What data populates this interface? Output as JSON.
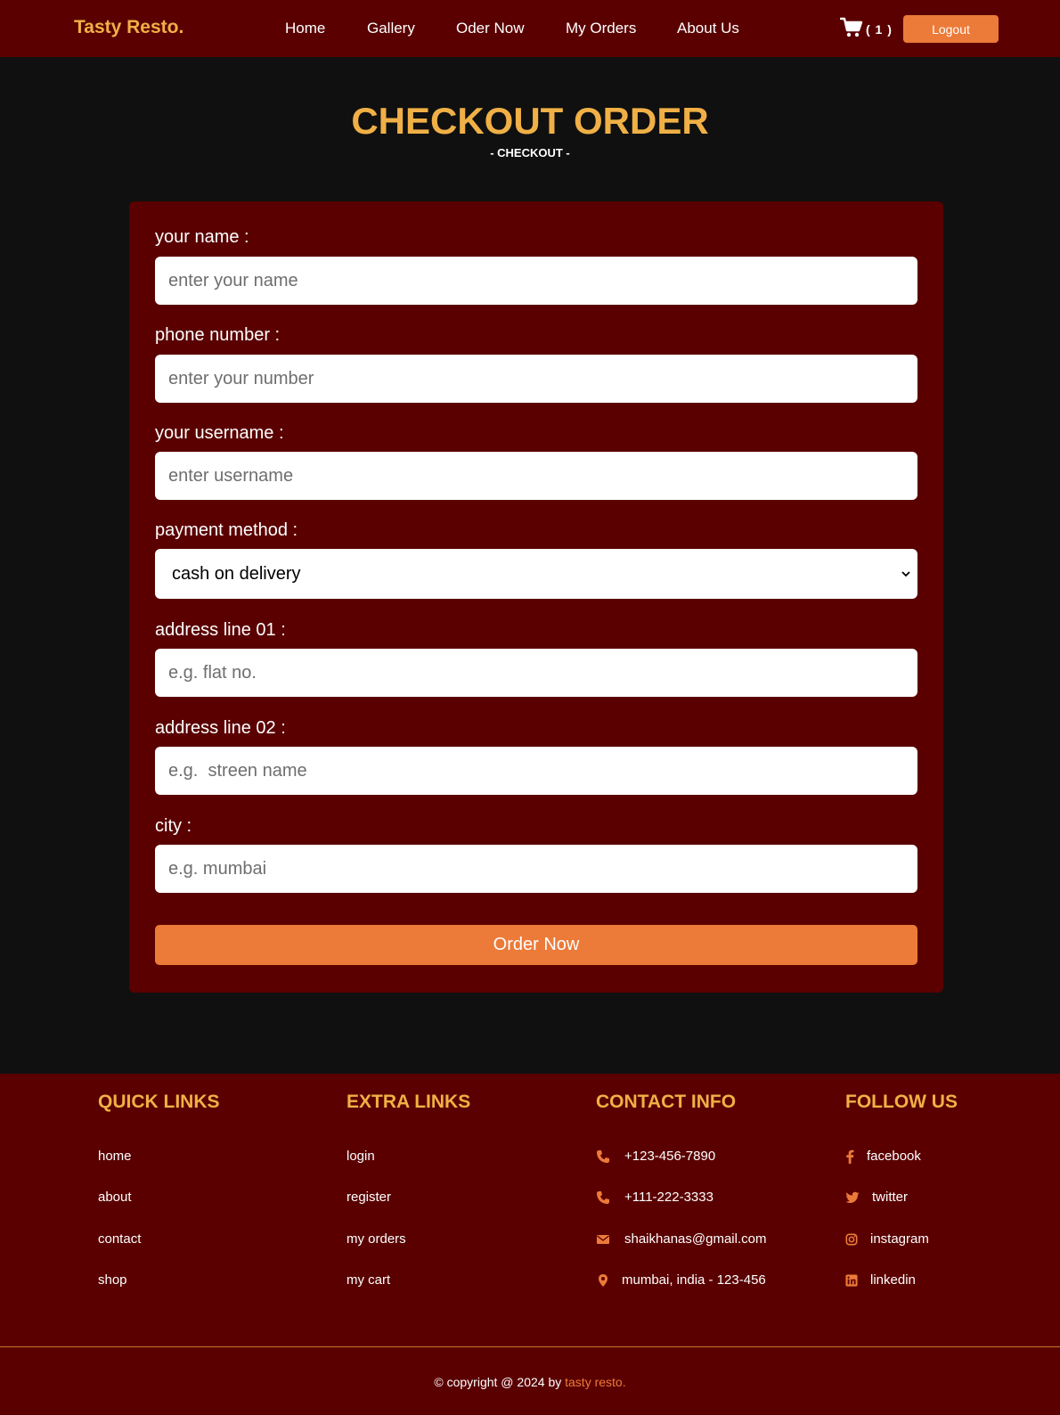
{
  "header": {
    "logo": "Tasty Resto.",
    "nav": [
      "Home",
      "Gallery",
      "Oder Now",
      "My Orders",
      "About Us"
    ],
    "cart_count": "( 1 )",
    "logout_label": "Logout"
  },
  "page": {
    "title": "CHECKOUT ORDER",
    "subtitle": "- CHECKOUT -"
  },
  "form": {
    "name_label": "your name :",
    "name_placeholder": "enter your name",
    "phone_label": "phone number :",
    "phone_placeholder": "enter your number",
    "username_label": "your username :",
    "username_placeholder": "enter username",
    "payment_label": "payment method :",
    "payment_value": "cash on delivery",
    "address1_label": "address line 01 :",
    "address1_placeholder": "e.g. flat no.",
    "address2_label": "address line 02 :",
    "address2_placeholder": "e.g.  streen name",
    "city_label": "city :",
    "city_placeholder": "e.g. mumbai",
    "submit_label": "Order Now"
  },
  "footer": {
    "quick_links": {
      "heading": "QUICK LINKS",
      "items": [
        "home",
        "about",
        "contact",
        "shop"
      ]
    },
    "extra_links": {
      "heading": "EXTRA LINKS",
      "items": [
        "login",
        "register",
        "my orders",
        "my cart"
      ]
    },
    "contact_info": {
      "heading": "CONTACT INFO",
      "items": [
        "+123-456-7890",
        "+111-222-3333",
        "shaikhanas@gmail.com",
        "mumbai, india - 123-456"
      ],
      "icons": [
        "phone-icon",
        "phone-icon",
        "envelope-icon",
        "map-marker-icon"
      ]
    },
    "follow_us": {
      "heading": "FOLLOW US",
      "items": [
        "facebook",
        "twitter",
        "instagram",
        "linkedin"
      ],
      "icons": [
        "facebook-icon",
        "twitter-icon",
        "instagram-icon",
        "linkedin-icon"
      ]
    },
    "copyright_prefix": "© copyright @ 2024 by ",
    "copyright_brand": "tasty resto."
  },
  "colors": {
    "header_bg": "#5a0000",
    "page_bg": "#101010",
    "accent_gold": "#f0b046",
    "accent_orange": "#ec7a39"
  }
}
